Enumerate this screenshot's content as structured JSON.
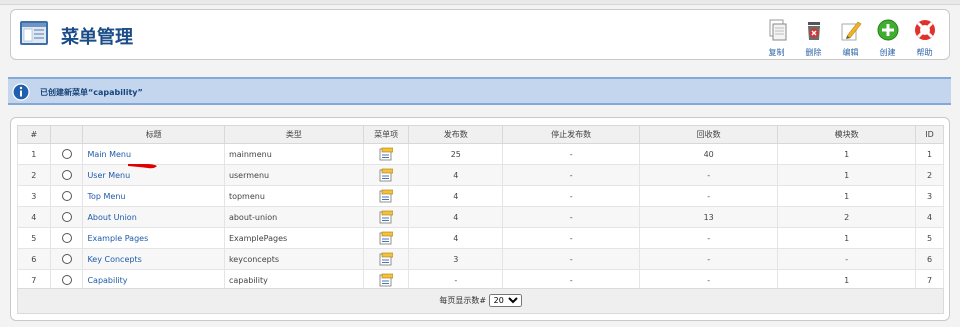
{
  "header": {
    "title": "菜单管理"
  },
  "toolbar": [
    {
      "label": "复制",
      "icon": "copy-icon"
    },
    {
      "label": "删除",
      "icon": "delete-icon"
    },
    {
      "label": "编辑",
      "icon": "edit-icon"
    },
    {
      "label": "创建",
      "icon": "create-icon"
    },
    {
      "label": "帮助",
      "icon": "help-icon"
    }
  ],
  "message": {
    "text": "已创建新菜单“capability”",
    "icon": "info-icon"
  },
  "table": {
    "columns": [
      "#",
      "",
      "标题",
      "类型",
      "菜单项",
      "发布数",
      "停止发布数",
      "回收数",
      "模块数",
      "ID"
    ],
    "rows": [
      {
        "num": "1",
        "title": "Main Menu",
        "type": "mainmenu",
        "published": "25",
        "unpublished": "-",
        "trashed": "40",
        "modules": "1",
        "id": "1"
      },
      {
        "num": "2",
        "title": "User Menu",
        "type": "usermenu",
        "published": "4",
        "unpublished": "-",
        "trashed": "-",
        "modules": "1",
        "id": "2"
      },
      {
        "num": "3",
        "title": "Top Menu",
        "type": "topmenu",
        "published": "4",
        "unpublished": "-",
        "trashed": "-",
        "modules": "1",
        "id": "3"
      },
      {
        "num": "4",
        "title": "About Union",
        "type": "about-union",
        "published": "4",
        "unpublished": "-",
        "trashed": "13",
        "modules": "2",
        "id": "4"
      },
      {
        "num": "5",
        "title": "Example Pages",
        "type": "ExamplePages",
        "published": "4",
        "unpublished": "-",
        "trashed": "-",
        "modules": "1",
        "id": "5"
      },
      {
        "num": "6",
        "title": "Key Concepts",
        "type": "keyconcepts",
        "published": "3",
        "unpublished": "-",
        "trashed": "-",
        "modules": "-",
        "id": "6"
      },
      {
        "num": "7",
        "title": "Capability",
        "type": "capability",
        "published": "-",
        "unpublished": "-",
        "trashed": "-",
        "modules": "1",
        "id": "7"
      }
    ]
  },
  "pager": {
    "label": "每页显示数#",
    "value": "20"
  },
  "colors": {
    "title": "#1a4c88",
    "link": "#1e5aa8",
    "message_bg": "#c3d6ed",
    "annotation": "#e00000"
  }
}
